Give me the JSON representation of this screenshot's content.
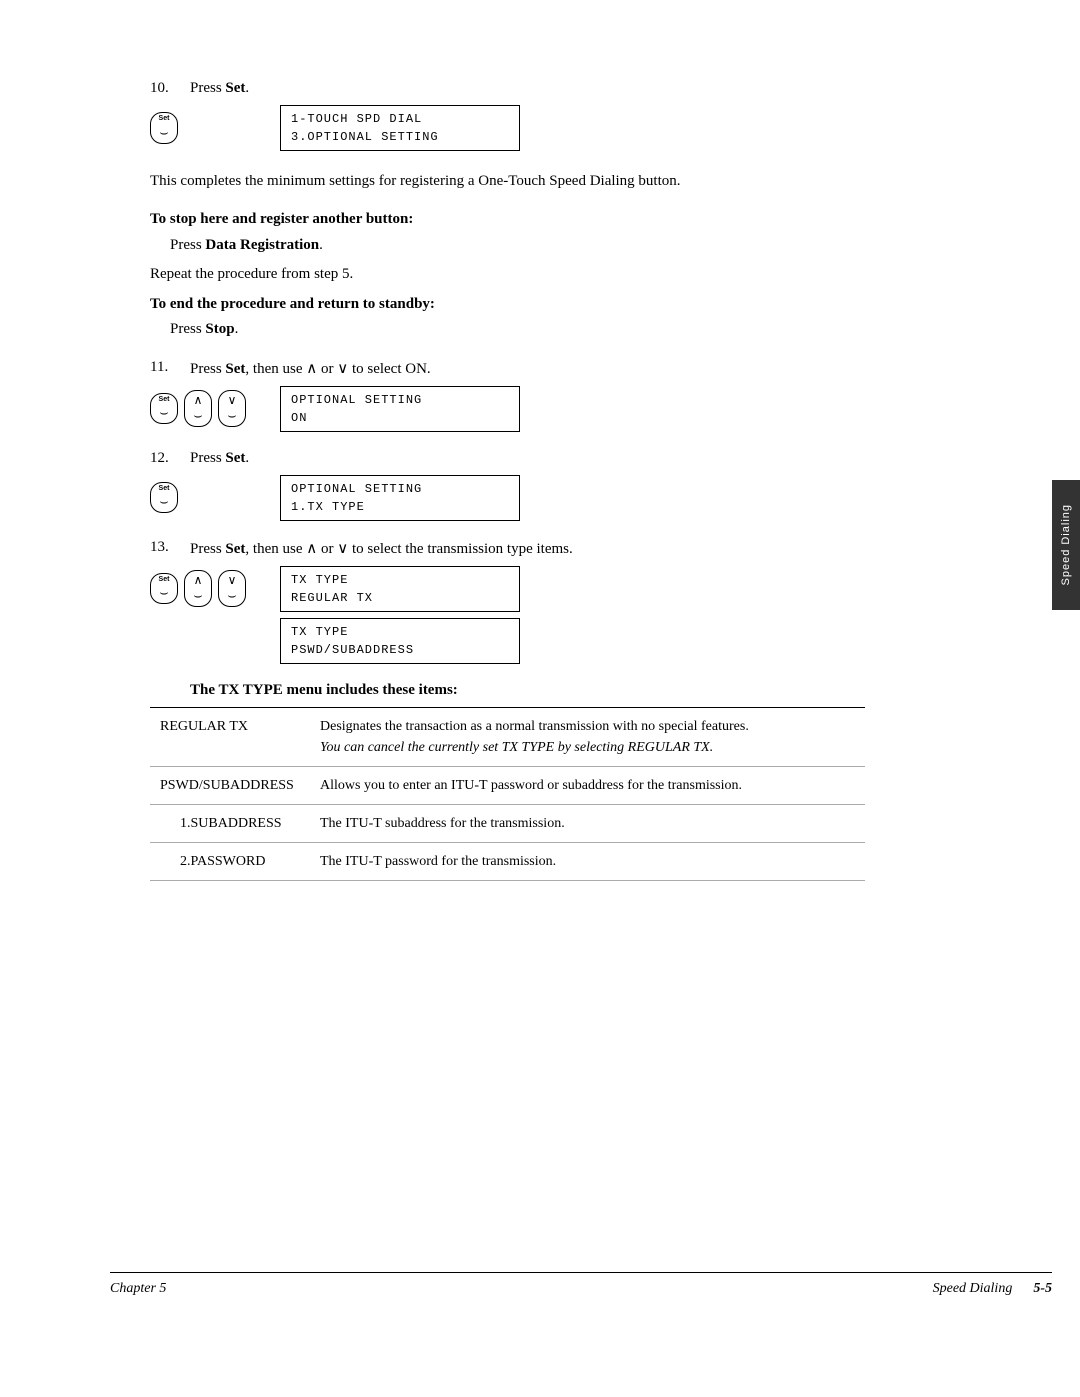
{
  "side_tab": {
    "label": "Speed Dialing"
  },
  "step10": {
    "number": "10.",
    "instruction": "Press Set.",
    "key_set": "Set",
    "lcd": {
      "line1": "1-TOUCH SPD DIAL",
      "line2": "3.OPTIONAL SETTING"
    }
  },
  "note": {
    "text": "This completes the minimum settings for registering a One-Touch Speed Dialing button."
  },
  "stop_instruction": {
    "heading": "To stop here and register another button:",
    "body1": "Press Data Registration.",
    "body2": "Repeat the procedure from step 5."
  },
  "end_instruction": {
    "heading": "To end the procedure and return to standby:",
    "body": "Press Stop."
  },
  "step11": {
    "number": "11.",
    "instruction_pre": "Press ",
    "bold1": "Set",
    "instruction_mid": ", then use ∧ or ∨ to select ON.",
    "lcd": {
      "line1": "OPTIONAL SETTING",
      "line2": "                ON"
    }
  },
  "step12": {
    "number": "12.",
    "instruction": "Press Set.",
    "lcd": {
      "line1": "OPTIONAL SETTING",
      "line2": "1.TX TYPE"
    }
  },
  "step13": {
    "number": "13.",
    "instruction_pre": "Press ",
    "bold1": "Set",
    "instruction_mid": ", then use ∧ or ∨ to select the transmission type items.",
    "lcd1": {
      "line1": "TX TYPE",
      "line2": "       REGULAR TX"
    },
    "lcd2": {
      "line1": "TX TYPE",
      "line2": "  PSWD/SUBADDRESS"
    }
  },
  "tx_type_section": {
    "title": "The TX TYPE menu includes these items:",
    "rows": [
      {
        "item": "REGULAR TX",
        "desc": "Designates the transaction as a normal transmission with no special features.",
        "note": "You can cancel the currently set TX TYPE by selecting REGULAR TX.",
        "sub": false
      },
      {
        "item": "PSWD/SUBADDRESS",
        "desc": "Allows you to enter an ITU-T password or subaddress for the transmission.",
        "note": "",
        "sub": false
      },
      {
        "item": "1.SUBADDRESS",
        "desc": "The ITU-T subaddress for the transmission.",
        "note": "",
        "sub": true
      },
      {
        "item": "2.PASSWORD",
        "desc": "The ITU-T password for the transmission.",
        "note": "",
        "sub": true
      }
    ]
  },
  "footer": {
    "left": "Chapter 5",
    "right": "Speed Dialing",
    "page": "5-5"
  }
}
